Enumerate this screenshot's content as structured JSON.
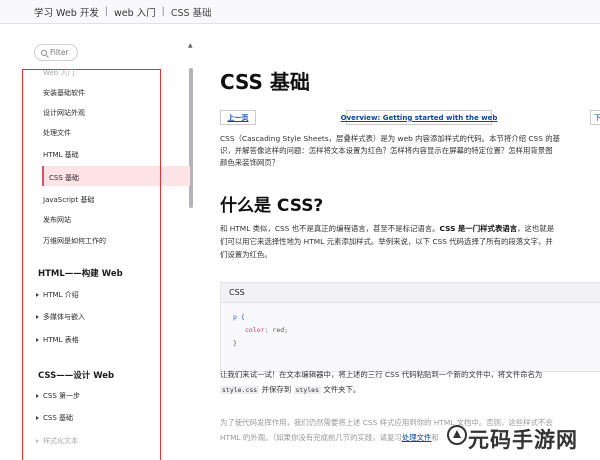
{
  "breadcrumb": {
    "items": [
      "学习 Web 开发",
      "web 入门",
      "CSS 基础"
    ],
    "separator": "|"
  },
  "sidebar": {
    "filter_label": "Filter",
    "nav_items": [
      {
        "label": "Web 入门",
        "state": "faded"
      },
      {
        "label": "安装基础软件",
        "state": "normal"
      },
      {
        "label": "设计网站外观",
        "state": "normal"
      },
      {
        "label": "处理文件",
        "state": "normal"
      },
      {
        "label": "HTML 基础",
        "state": "normal"
      },
      {
        "label": "CSS 基础",
        "state": "active"
      },
      {
        "label": "JavaScript 基础",
        "state": "normal"
      },
      {
        "label": "发布网站",
        "state": "normal"
      },
      {
        "label": "万维网是如何工作的",
        "state": "normal"
      }
    ],
    "sections": [
      {
        "title": "HTML——构建 Web",
        "items": [
          "HTML 介绍",
          "多媒体与嵌入",
          "HTML 表格"
        ]
      },
      {
        "title": "CSS——设计 Web",
        "items": [
          "CSS 第一步",
          "CSS 基础",
          "样式化文本"
        ]
      }
    ]
  },
  "main": {
    "title": "CSS 基础",
    "nav": {
      "prev": "上一页",
      "overview": "Overview: Getting started with the web",
      "next_partial": "下"
    },
    "intro": [
      "CSS（Cascading Style Sheets，层叠样式表）是为 web 内容添加样式的代码。本节将介绍 CSS 的基",
      "识，并解答像这样的问题：怎样将文本设置为红色？怎样将内容显示在屏幕的特定位置？怎样用背景图",
      "颜色来装饰网页？"
    ],
    "h2": "什么是 CSS?",
    "what_para": [
      {
        "pre": "和 HTML 类似，CSS 也不是真正的编程语言，甚至不是标记语言。",
        "bold": "CSS 是一门样式表语言",
        "post": "，这也就是"
      },
      {
        "pre": "们可以用它来选择性地为 HTML 元素添加样式。举例来说，以下 CSS 代码选择了所有的段落文字，并"
      },
      {
        "pre": "们设置为红色。"
      }
    ],
    "code": {
      "header": "CSS",
      "line1_selector": "p {",
      "line2_prop": "color",
      "line2_value": ": red;",
      "line3": "}"
    },
    "try_para": {
      "line1": "让我们来试一试！在文本编辑器中，将上述的三行 CSS 代码粘贴到一个新的文件中，将文件命名为",
      "code1": "style.css",
      "mid": " 并保存到 ",
      "code2": "styles",
      "end": " 文件夹下。"
    },
    "faded_para": {
      "line1": "为了使代码发挥作用，我们仍然需要将上述 CSS 样式应用到你的 HTML 文档中。否则，这些样式不会",
      "line2_pre": "HTML 的外观。（如果你没有完成前几节的实践，请复习",
      "line2_link": "处理文件",
      "line2_post": "和"
    }
  },
  "watermark": "元码手游网",
  "colors": {
    "active_bg": "#fde2e6",
    "active_bar": "#e25267",
    "highlight_box": "#e03434",
    "link": "#0645ad"
  }
}
